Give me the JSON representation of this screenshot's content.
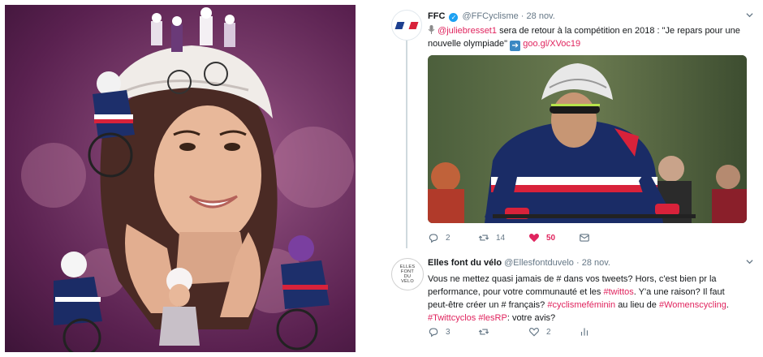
{
  "tweets": [
    {
      "name": "FFC",
      "handle": "@FFCyclisme",
      "date": "28 nov.",
      "mention": "@juliebresset1",
      "text": "sera de retour à la compétition en 2018 : \"Je repars pour une nouvelle olympiade\"",
      "link": "goo.gl/XVoc19",
      "replies": "2",
      "retweets": "14",
      "likes": "50",
      "liked": true
    },
    {
      "name": "Elles font du vélo",
      "handle": "@Ellesfontduvelo",
      "date": "28 nov.",
      "text_part1": "Vous ne mettez quasi jamais de # dans vos tweets? Hors, c'est bien pr la performance, pour votre communauté et les",
      "hashtag1": "#twittos",
      "text_part2": ". Y'a une raison? Il faut peut-être créer un # français?",
      "hashtag2": "#cyclismeféminin",
      "text_part3": "au lieu de",
      "hashtag3": "#Womenscycling",
      "hashtag4": "#Twittcyclos",
      "hashtag5": "#lesRP",
      "text_part4": ": votre avis?",
      "replies": "3",
      "retweets": "",
      "likes": "2",
      "liked": false
    }
  ],
  "avatars": {
    "efv_lines": [
      "ELLES",
      "FONT",
      "DU",
      "VÉLO"
    ]
  },
  "colors": {
    "link": "#e0245e",
    "verified": "#1da1f2",
    "muted": "#657786",
    "poster_bg": "#6b2f5f"
  },
  "icons": {
    "reply": "reply-icon",
    "retweet": "retweet-icon",
    "like": "heart-icon",
    "dm": "envelope-icon",
    "analytics": "analytics-icon",
    "caret": "chevron-down-icon"
  }
}
